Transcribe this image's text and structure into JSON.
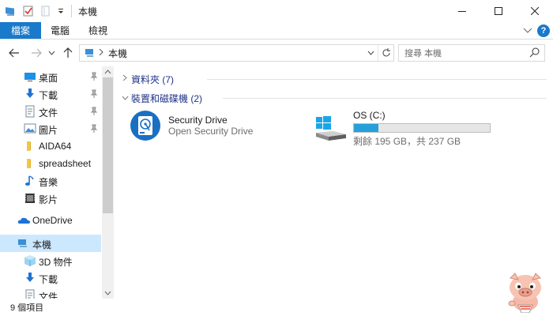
{
  "window": {
    "title": "本機"
  },
  "ribbon": {
    "tabs": [
      {
        "label": "檔案"
      },
      {
        "label": "電腦"
      },
      {
        "label": "檢視"
      }
    ],
    "help_label": "?"
  },
  "address": {
    "crumb": "本機",
    "search_placeholder": "搜尋 本機"
  },
  "sidebar": {
    "items": [
      {
        "label": "桌面",
        "icon": "desktop-icon",
        "pinned": true
      },
      {
        "label": "下載",
        "icon": "download-icon",
        "pinned": true
      },
      {
        "label": "文件",
        "icon": "document-icon",
        "pinned": true
      },
      {
        "label": "圖片",
        "icon": "pictures-icon",
        "pinned": true
      },
      {
        "label": "AIDA64",
        "icon": "folder-icon",
        "pinned": false
      },
      {
        "label": "spreadsheet",
        "icon": "folder-icon",
        "pinned": false
      },
      {
        "label": "音樂",
        "icon": "music-icon",
        "pinned": false
      },
      {
        "label": "影片",
        "icon": "video-icon",
        "pinned": false
      },
      {
        "label": "OneDrive",
        "icon": "onedrive-icon",
        "pinned": false
      },
      {
        "label": "本機",
        "icon": "this-pc-icon",
        "pinned": false,
        "selected": true
      },
      {
        "label": "3D 物件",
        "icon": "3d-objects-icon",
        "pinned": false
      },
      {
        "label": "下載",
        "icon": "download-icon",
        "pinned": false
      },
      {
        "label": "文件",
        "icon": "document-icon",
        "pinned": false
      }
    ]
  },
  "content": {
    "groups": [
      {
        "label": "資料夾 (7)",
        "expanded": false
      },
      {
        "label": "裝置和磁碟機 (2)",
        "expanded": true
      }
    ],
    "devices": [
      {
        "name": "Security Drive",
        "subtitle": "Open Security Drive",
        "icon": "security-drive-icon"
      },
      {
        "name": "OS (C:)",
        "subtitle": "剩餘 195 GB，共 237 GB",
        "icon": "windows-drive-icon",
        "used_fraction": 0.18
      }
    ]
  },
  "status": {
    "text": "9 個項目"
  },
  "colors": {
    "accent": "#1979ca",
    "selection": "#cce8ff",
    "drive_fill": "#26a0da",
    "group_text": "#1e3287"
  }
}
